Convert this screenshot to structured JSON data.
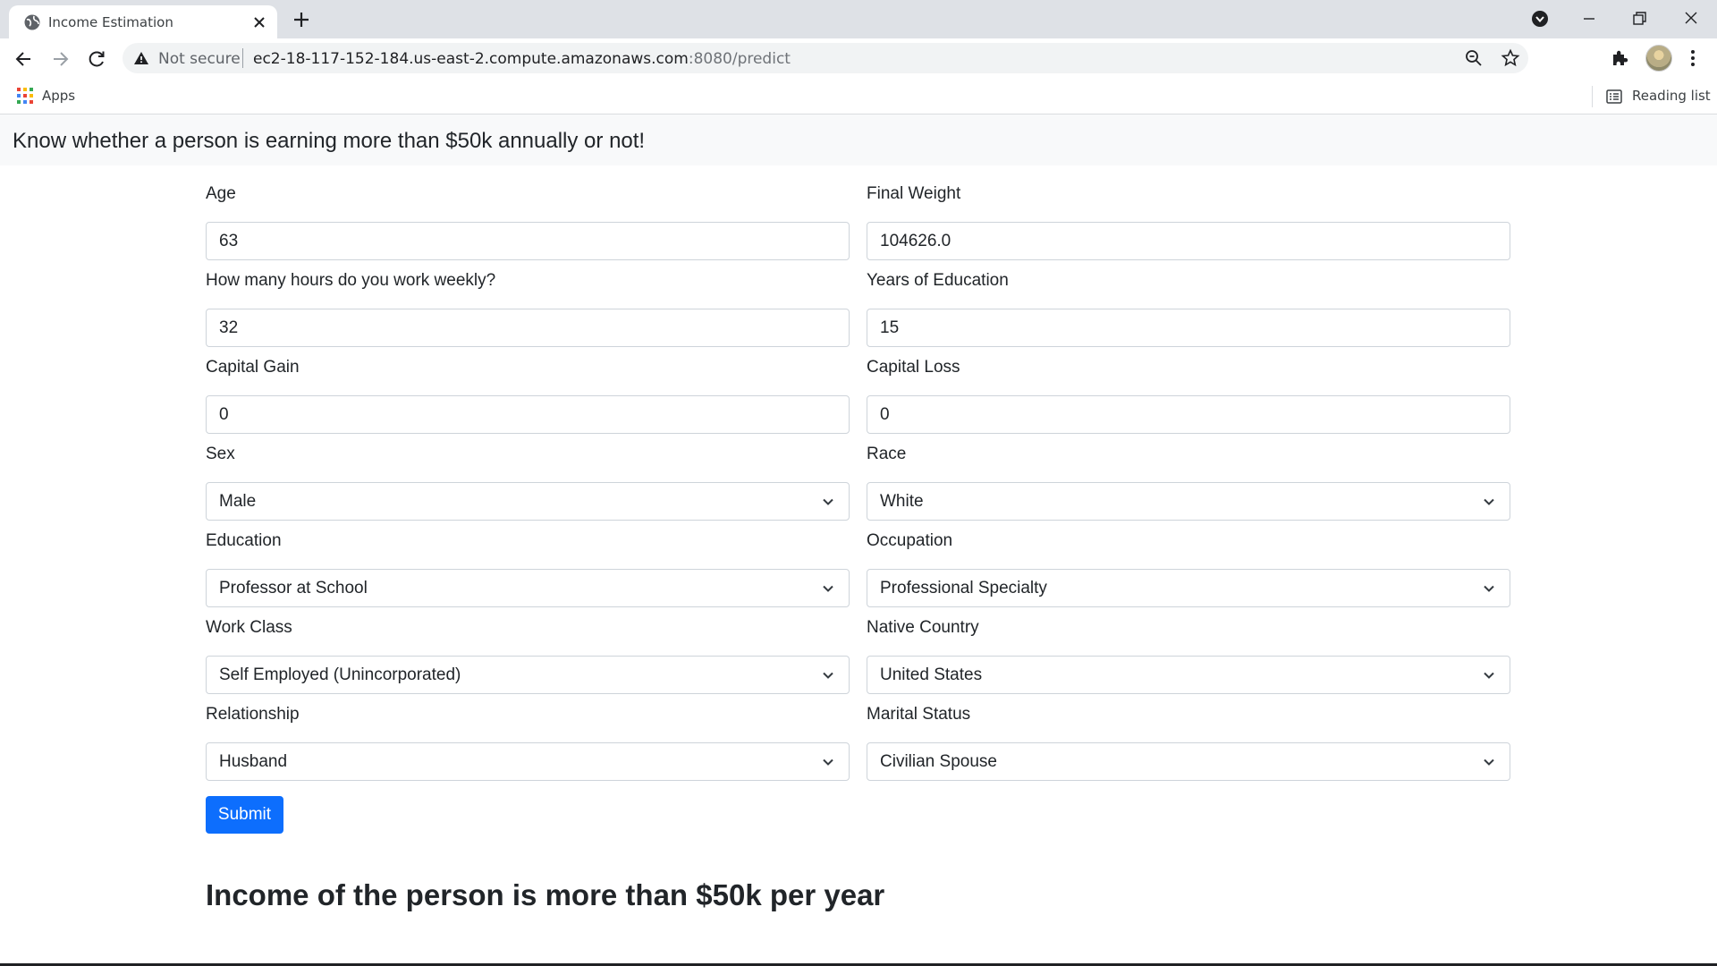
{
  "browser": {
    "tab_title": "Income Estimation",
    "security_text": "Not secure",
    "url_host": "ec2-18-117-152-184.us-east-2.compute.amazonaws.com",
    "url_rest": ":8080/predict",
    "bookmarks": {
      "apps_label": "Apps",
      "reading_list_label": "Reading list"
    }
  },
  "header": {
    "brand": "Know whether a person is earning more than $50k annually or not!"
  },
  "form": {
    "age": {
      "label": "Age",
      "value": "63"
    },
    "final_weight": {
      "label": "Final Weight",
      "value": "104626.0"
    },
    "hours": {
      "label": "How many hours do you work weekly?",
      "value": "32"
    },
    "years_education": {
      "label": "Years of Education",
      "value": "15"
    },
    "capital_gain": {
      "label": "Capital Gain",
      "value": "0"
    },
    "capital_loss": {
      "label": "Capital Loss",
      "value": "0"
    },
    "sex": {
      "label": "Sex",
      "value": "Male"
    },
    "race": {
      "label": "Race",
      "value": "White"
    },
    "education": {
      "label": "Education",
      "value": "Professor at School"
    },
    "occupation": {
      "label": "Occupation",
      "value": "Professional Specialty"
    },
    "work_class": {
      "label": "Work Class",
      "value": "Self Employed (Unincorporated)"
    },
    "native_country": {
      "label": "Native Country",
      "value": "United States"
    },
    "relationship": {
      "label": "Relationship",
      "value": "Husband"
    },
    "marital_status": {
      "label": "Marital Status",
      "value": "Civilian Spouse"
    },
    "submit_label": "Submit"
  },
  "result": {
    "text": "Income of the person is more than $50k per year"
  },
  "colors": {
    "primary": "#0d6efd",
    "header_bg": "#f8f9fa",
    "tabstrip_bg": "#dee1e6"
  }
}
